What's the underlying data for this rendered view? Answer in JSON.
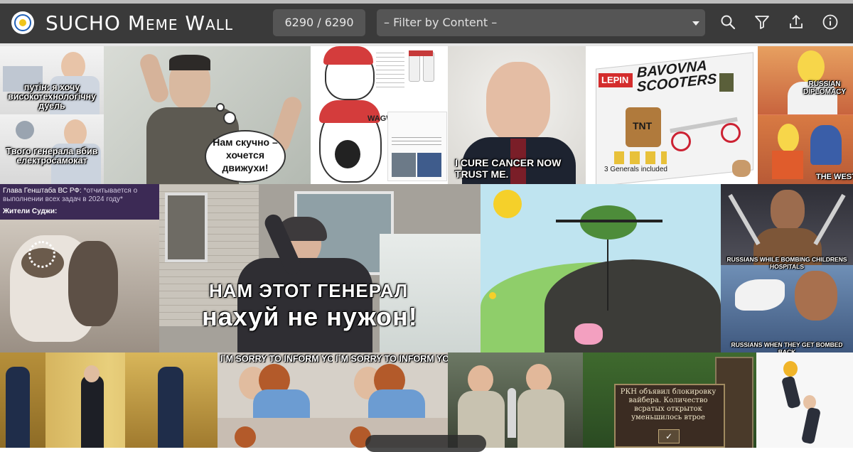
{
  "app": {
    "title_main": "SUCHO",
    "title_meme": "Meme",
    "title_wall": "Wall",
    "counter": "6290 / 6290",
    "filter_placeholder": "– Filter by Content –"
  },
  "toolbar": {
    "search_icon": "search-icon",
    "filter_icon": "filter-icon",
    "upload_icon": "upload-icon",
    "info_icon": "info-icon"
  },
  "memes": {
    "harold_top": "путін: я хочу\nвисокотехнологічну\nдуель",
    "harold_bottom": "Твого генерала вбив\nелектросамокат",
    "hitler_bubble": "Нам скучно –\nхочется\nдвижухи!",
    "wojak_label": "WAGW!",
    "putin_caption": "I CURE CANCER NOW\nTRUST ME.",
    "lego_title": "BAVOVNA\nSCOOTERS",
    "lego_brand": "LEPIN",
    "lego_tnt": "TNT",
    "lego_generals": "3 Generals included",
    "simpsons_top": "RUSSIAN\nDIPLOMACY",
    "simpsons_bottom": "THE WEST",
    "cat_header": "Глава Генштаба ВС РФ:",
    "cat_header_quote": " *отчитывается о выполнении всех задач в 2024 году*",
    "cat_sub": "Жители Суджи:",
    "woman_line1": "НАМ ЭТОТ ГЕНЕРАЛ",
    "woman_line2": "нахуй не нужон!",
    "danny_top": "RUSSIANS WHILE BOMBING CHILDRENS HOSPITALS",
    "danny_bottom": "RUSSIANS WHEN THEY GET BOMBED BACK",
    "sorry_a": "I`M SORRY TO INFORM YOU",
    "sorry_b": "I`M SORRY TO INFORM YOU",
    "heroes_text": "РКН объявил блокировку\nвайбера. Количество\nвсратых открыток\nуменьшилось втрое"
  },
  "colors": {
    "header_bg": "#3a3a3a",
    "control_bg": "#555555",
    "accent_blue": "#1f5fb5"
  }
}
